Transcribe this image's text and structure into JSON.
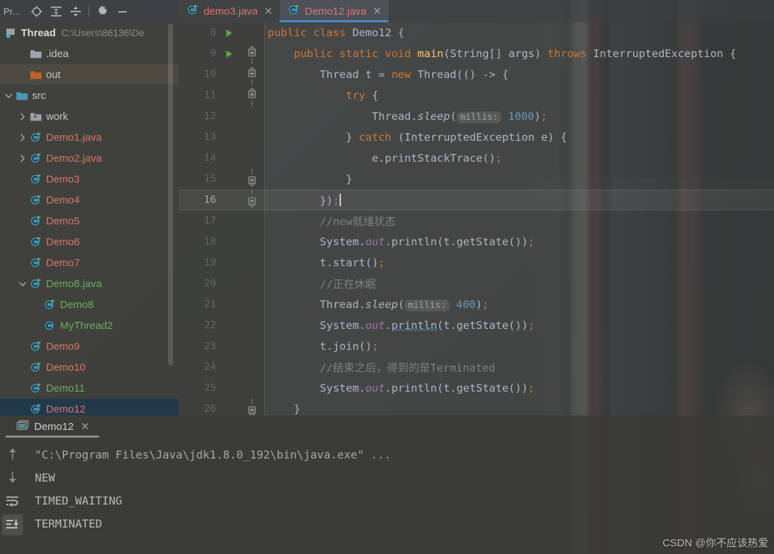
{
  "toolwindow": {
    "title": "Pr...",
    "icons": [
      {
        "name": "locate-icon",
        "label": "Select Opened File"
      },
      {
        "name": "expand-all-icon",
        "label": "Expand All"
      },
      {
        "name": "collapse-all-icon",
        "label": "Collapse All"
      },
      {
        "name": "gear-icon",
        "label": "Settings"
      },
      {
        "name": "minimize-icon",
        "label": "Hide"
      }
    ]
  },
  "project_tree": {
    "root": {
      "label": "Thread",
      "path": "C:\\Users\\86136\\De"
    },
    "items": [
      {
        "label": ".idea",
        "arrow": "none",
        "icon": "folder-gray",
        "color": "plain",
        "indent": 1,
        "state": "normal"
      },
      {
        "label": "out",
        "arrow": "none",
        "icon": "folder-orange",
        "color": "plain",
        "indent": 1,
        "state": "hover"
      },
      {
        "label": "src",
        "arrow": "expanded",
        "icon": "folder-blue",
        "color": "plain",
        "indent": 0,
        "state": "normal"
      },
      {
        "label": "work",
        "arrow": "collapsed",
        "icon": "folder-pkg",
        "color": "plain",
        "indent": 1,
        "state": "normal"
      },
      {
        "label": "Demo1.java",
        "arrow": "collapsed",
        "icon": "class-run",
        "color": "red",
        "indent": 1,
        "state": "normal"
      },
      {
        "label": "Demo2.java",
        "arrow": "collapsed",
        "icon": "class-run",
        "color": "red",
        "indent": 1,
        "state": "normal"
      },
      {
        "label": "Demo3",
        "arrow": "none",
        "icon": "class-run",
        "color": "red",
        "indent": 1,
        "state": "normal"
      },
      {
        "label": "Demo4",
        "arrow": "none",
        "icon": "class-run",
        "color": "red",
        "indent": 1,
        "state": "normal"
      },
      {
        "label": "Demo5",
        "arrow": "none",
        "icon": "class-run",
        "color": "red",
        "indent": 1,
        "state": "normal"
      },
      {
        "label": "Demo6",
        "arrow": "none",
        "icon": "class-run",
        "color": "red",
        "indent": 1,
        "state": "normal"
      },
      {
        "label": "Demo7",
        "arrow": "none",
        "icon": "class-run",
        "color": "red",
        "indent": 1,
        "state": "normal"
      },
      {
        "label": "Demo8.java",
        "arrow": "expanded",
        "icon": "class-run",
        "color": "green",
        "indent": 1,
        "state": "normal"
      },
      {
        "label": "Demo8",
        "arrow": "none",
        "icon": "class-run",
        "color": "green",
        "indent": 2,
        "state": "normal"
      },
      {
        "label": "MyThread2",
        "arrow": "none",
        "icon": "class-plain",
        "color": "green",
        "indent": 2,
        "state": "normal"
      },
      {
        "label": "Demo9",
        "arrow": "none",
        "icon": "class-run",
        "color": "red",
        "indent": 1,
        "state": "normal"
      },
      {
        "label": "Demo10",
        "arrow": "none",
        "icon": "class-run",
        "color": "red",
        "indent": 1,
        "state": "normal"
      },
      {
        "label": "Demo11",
        "arrow": "none",
        "icon": "class-run",
        "color": "green",
        "indent": 1,
        "state": "normal"
      },
      {
        "label": "Demo12",
        "arrow": "none",
        "icon": "class-run",
        "color": "red",
        "indent": 1,
        "state": "selected"
      }
    ]
  },
  "editor_tabs": [
    {
      "label": "demo3.java",
      "active": false
    },
    {
      "label": "Demo12.java",
      "active": true
    }
  ],
  "editor": {
    "lines": [
      {
        "num": "8",
        "run": true,
        "fold": "none",
        "current": false,
        "tokens": [
          {
            "t": "public ",
            "c": "k"
          },
          {
            "t": "class ",
            "c": "k"
          },
          {
            "t": "Demo12 {",
            "c": "id"
          }
        ]
      },
      {
        "num": "9",
        "run": true,
        "fold": "start",
        "current": false,
        "tokens": [
          {
            "t": "    ",
            "c": "id"
          },
          {
            "t": "public ",
            "c": "k"
          },
          {
            "t": "static ",
            "c": "k"
          },
          {
            "t": "void ",
            "c": "k"
          },
          {
            "t": "main",
            "c": "mth"
          },
          {
            "t": "(String[] args) ",
            "c": "id"
          },
          {
            "t": "throws ",
            "c": "k"
          },
          {
            "t": "InterruptedException {",
            "c": "id"
          }
        ]
      },
      {
        "num": "10",
        "run": false,
        "fold": "start",
        "current": false,
        "tokens": [
          {
            "t": "        Thread t = ",
            "c": "id"
          },
          {
            "t": "new ",
            "c": "k"
          },
          {
            "t": "Thread(() -> {",
            "c": "id"
          }
        ]
      },
      {
        "num": "11",
        "run": false,
        "fold": "start",
        "current": false,
        "tokens": [
          {
            "t": "            ",
            "c": "id"
          },
          {
            "t": "try",
            "c": "k"
          },
          {
            "t": " {",
            "c": "id"
          }
        ]
      },
      {
        "num": "12",
        "run": false,
        "fold": "none",
        "current": false,
        "tokens": [
          {
            "t": "                Thread.",
            "c": "id"
          },
          {
            "t": "sleep",
            "c": "sit"
          },
          {
            "t": "(",
            "c": "id"
          },
          {
            "t": "millis:",
            "c": "hint"
          },
          {
            "t": " ",
            "c": "id"
          },
          {
            "t": "1000",
            "c": "num"
          },
          {
            "t": ")",
            "c": "id"
          },
          {
            "t": ";",
            "c": "semi"
          }
        ]
      },
      {
        "num": "13",
        "run": false,
        "fold": "none",
        "current": false,
        "tokens": [
          {
            "t": "            } ",
            "c": "id"
          },
          {
            "t": "catch ",
            "c": "k"
          },
          {
            "t": "(InterruptedException e) {",
            "c": "id"
          }
        ]
      },
      {
        "num": "14",
        "run": false,
        "fold": "none",
        "current": false,
        "tokens": [
          {
            "t": "                e.printStackTrace()",
            "c": "id"
          },
          {
            "t": ";",
            "c": "semi"
          }
        ]
      },
      {
        "num": "15",
        "run": false,
        "fold": "end",
        "current": false,
        "tokens": [
          {
            "t": "            }",
            "c": "id"
          }
        ]
      },
      {
        "num": "16",
        "run": false,
        "fold": "endcur",
        "current": true,
        "tokens": [
          {
            "t": "        })",
            "c": "id"
          },
          {
            "t": ";",
            "c": "semi"
          },
          {
            "t": "CARET",
            "c": "caret"
          }
        ]
      },
      {
        "num": "17",
        "run": false,
        "fold": "none",
        "current": false,
        "tokens": [
          {
            "t": "        //new就绪状态",
            "c": "cm"
          }
        ]
      },
      {
        "num": "18",
        "run": false,
        "fold": "none",
        "current": false,
        "tokens": [
          {
            "t": "        System.",
            "c": "id"
          },
          {
            "t": "out",
            "c": "st"
          },
          {
            "t": ".println(t.getState())",
            "c": "id"
          },
          {
            "t": ";",
            "c": "semi"
          }
        ]
      },
      {
        "num": "19",
        "run": false,
        "fold": "none",
        "current": false,
        "tokens": [
          {
            "t": "        t.start()",
            "c": "id"
          },
          {
            "t": ";",
            "c": "semi"
          }
        ]
      },
      {
        "num": "20",
        "run": false,
        "fold": "none",
        "current": false,
        "tokens": [
          {
            "t": "        //正在休眠",
            "c": "cm"
          }
        ]
      },
      {
        "num": "21",
        "run": false,
        "fold": "none",
        "current": false,
        "tokens": [
          {
            "t": "        Thread.",
            "c": "id"
          },
          {
            "t": "sleep",
            "c": "sit"
          },
          {
            "t": "(",
            "c": "id"
          },
          {
            "t": "millis:",
            "c": "hint"
          },
          {
            "t": " ",
            "c": "id"
          },
          {
            "t": "400",
            "c": "num"
          },
          {
            "t": ")",
            "c": "id"
          },
          {
            "t": ";",
            "c": "semi"
          }
        ]
      },
      {
        "num": "22",
        "run": false,
        "fold": "none",
        "current": false,
        "tokens": [
          {
            "t": "        System.",
            "c": "id"
          },
          {
            "t": "out",
            "c": "st"
          },
          {
            "t": ".",
            "c": "id"
          },
          {
            "t": "println",
            "c": "ul"
          },
          {
            "t": "(t.getState())",
            "c": "id"
          },
          {
            "t": ";",
            "c": "semi"
          }
        ]
      },
      {
        "num": "23",
        "run": false,
        "fold": "none",
        "current": false,
        "tokens": [
          {
            "t": "        t.join()",
            "c": "id"
          },
          {
            "t": ";",
            "c": "semi"
          }
        ]
      },
      {
        "num": "24",
        "run": false,
        "fold": "none",
        "current": false,
        "tokens": [
          {
            "t": "        //结束之后，得到的是Terminated",
            "c": "cm"
          }
        ]
      },
      {
        "num": "25",
        "run": false,
        "fold": "none",
        "current": false,
        "tokens": [
          {
            "t": "        System.",
            "c": "id"
          },
          {
            "t": "out",
            "c": "st"
          },
          {
            "t": ".println(t.getState())",
            "c": "id"
          },
          {
            "t": ";",
            "c": "semi"
          }
        ]
      },
      {
        "num": "26",
        "run": false,
        "fold": "end",
        "current": false,
        "tokens": [
          {
            "t": "    }",
            "c": "id"
          }
        ]
      }
    ]
  },
  "run_window": {
    "tab_label": "Demo12",
    "sidebar_buttons": [
      {
        "name": "scroll-up-icon",
        "active": false
      },
      {
        "name": "scroll-down-icon",
        "active": false
      },
      {
        "name": "soft-wrap-icon",
        "active": false
      },
      {
        "name": "scroll-to-end-icon",
        "active": true
      }
    ],
    "console_lines": [
      {
        "text": "\"C:\\Program Files\\Java\\jdk1.8.0_192\\bin\\java.exe\" ...",
        "kind": "cmd"
      },
      {
        "text": "NEW",
        "kind": "out"
      },
      {
        "text": "TIMED_WAITING",
        "kind": "out"
      },
      {
        "text": "TERMINATED",
        "kind": "out"
      }
    ]
  },
  "watermark": {
    "text": "CSDN @你不应该热爱"
  },
  "colors": {
    "accent_blue": "#4a88c7",
    "keyword_orange": "#cc7832",
    "identifier": "#a9b7c6",
    "number_blue": "#6897bb",
    "comment_gray": "#808080",
    "static_purple": "#9876aa",
    "method_yellow": "#ffc66d",
    "file_red": "#d9776a",
    "file_green": "#6aaf5e",
    "selection_blue": "#1f384e"
  }
}
